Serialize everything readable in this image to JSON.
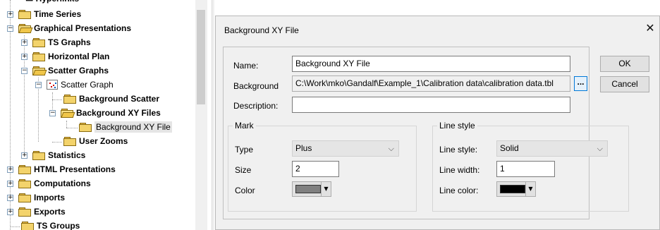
{
  "tree": {
    "items": [
      {
        "label": "Time Series"
      },
      {
        "label": "Graphical Presentations"
      },
      {
        "label": "TS Graphs"
      },
      {
        "label": "Horizontal Plan"
      },
      {
        "label": "Scatter Graphs"
      },
      {
        "label": "Scatter Graph"
      },
      {
        "label": "Background Scatter"
      },
      {
        "label": "Background XY Files"
      },
      {
        "label": "Background XY File"
      },
      {
        "label": "User Zooms"
      },
      {
        "label": "Statistics"
      },
      {
        "label": "HTML Presentations"
      },
      {
        "label": "Computations"
      },
      {
        "label": "Imports"
      },
      {
        "label": "Exports"
      },
      {
        "label": "TS Groups"
      }
    ]
  },
  "dialog": {
    "title": "Background XY File",
    "close_icon": "close-icon",
    "name_label": "Name:",
    "name_value": "Background XY File",
    "background_label": "Background",
    "background_value": "C:\\Work\\mko\\Gandalf\\Example_1\\Calibration data\\calibration data.tbl",
    "browse_label": "...",
    "description_label": "Description:",
    "description_value": "",
    "ok_label": "OK",
    "cancel_label": "Cancel",
    "mark": {
      "group_label": "Mark",
      "type_label": "Type",
      "type_value": "Plus",
      "size_label": "Size",
      "size_value": "2",
      "color_label": "Color",
      "color_hex": "#808080"
    },
    "line_style": {
      "group_label": "Line style",
      "style_label": "Line style:",
      "style_value": "Solid",
      "width_label": "Line width:",
      "width_value": "1",
      "color_label": "Line color:",
      "color_hex": "#000000"
    }
  }
}
